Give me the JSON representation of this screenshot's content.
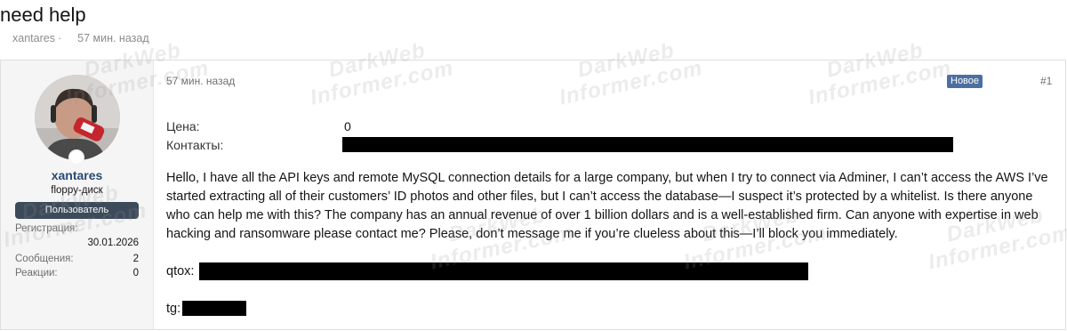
{
  "thread": {
    "title": "need help",
    "author": "xantares",
    "separator": "·",
    "time": "57 мин. назад"
  },
  "sidebar": {
    "username": "xantares",
    "user_title": "floppy-диск",
    "banner": "Пользователь",
    "stats": {
      "registration_label": "Регистрация:",
      "registration_value": "30.01.2026",
      "messages_label": "Сообщения:",
      "messages_value": "2",
      "reactions_label": "Реакции:",
      "reactions_value": "0"
    }
  },
  "post": {
    "date": "57 мин. назад",
    "new_badge": "Новое",
    "number": "#1",
    "price_label": "Цена:",
    "price_value": "0",
    "contacts_label": "Контакты:",
    "body": "Hello, I have all the API keys and remote MySQL connection details for a large company, but when I try to connect via Adminer, I can’t access the AWS I’ve started extracting all of their customers’ ID photos and other files, but I can’t access the database—I suspect it’s protected by a whitelist. Is there anyone who can help me with this? The company has an annual revenue of over 1 billion dollars and is a well-established firm. Can anyone with expertise in web hacking and ransomware please contact me? Please, don’t message me if you’re clueless about this—I’ll block you immediately.",
    "qtox_label": "qtox:",
    "tg_label": "tg:"
  },
  "watermark": {
    "line1": "DarkWeb",
    "line2": "Informer.com"
  },
  "colors": {
    "username": "#2a4a73",
    "banner": "#3c4a5a",
    "new_badge": "#4d6f9f",
    "redaction": "#000000"
  }
}
